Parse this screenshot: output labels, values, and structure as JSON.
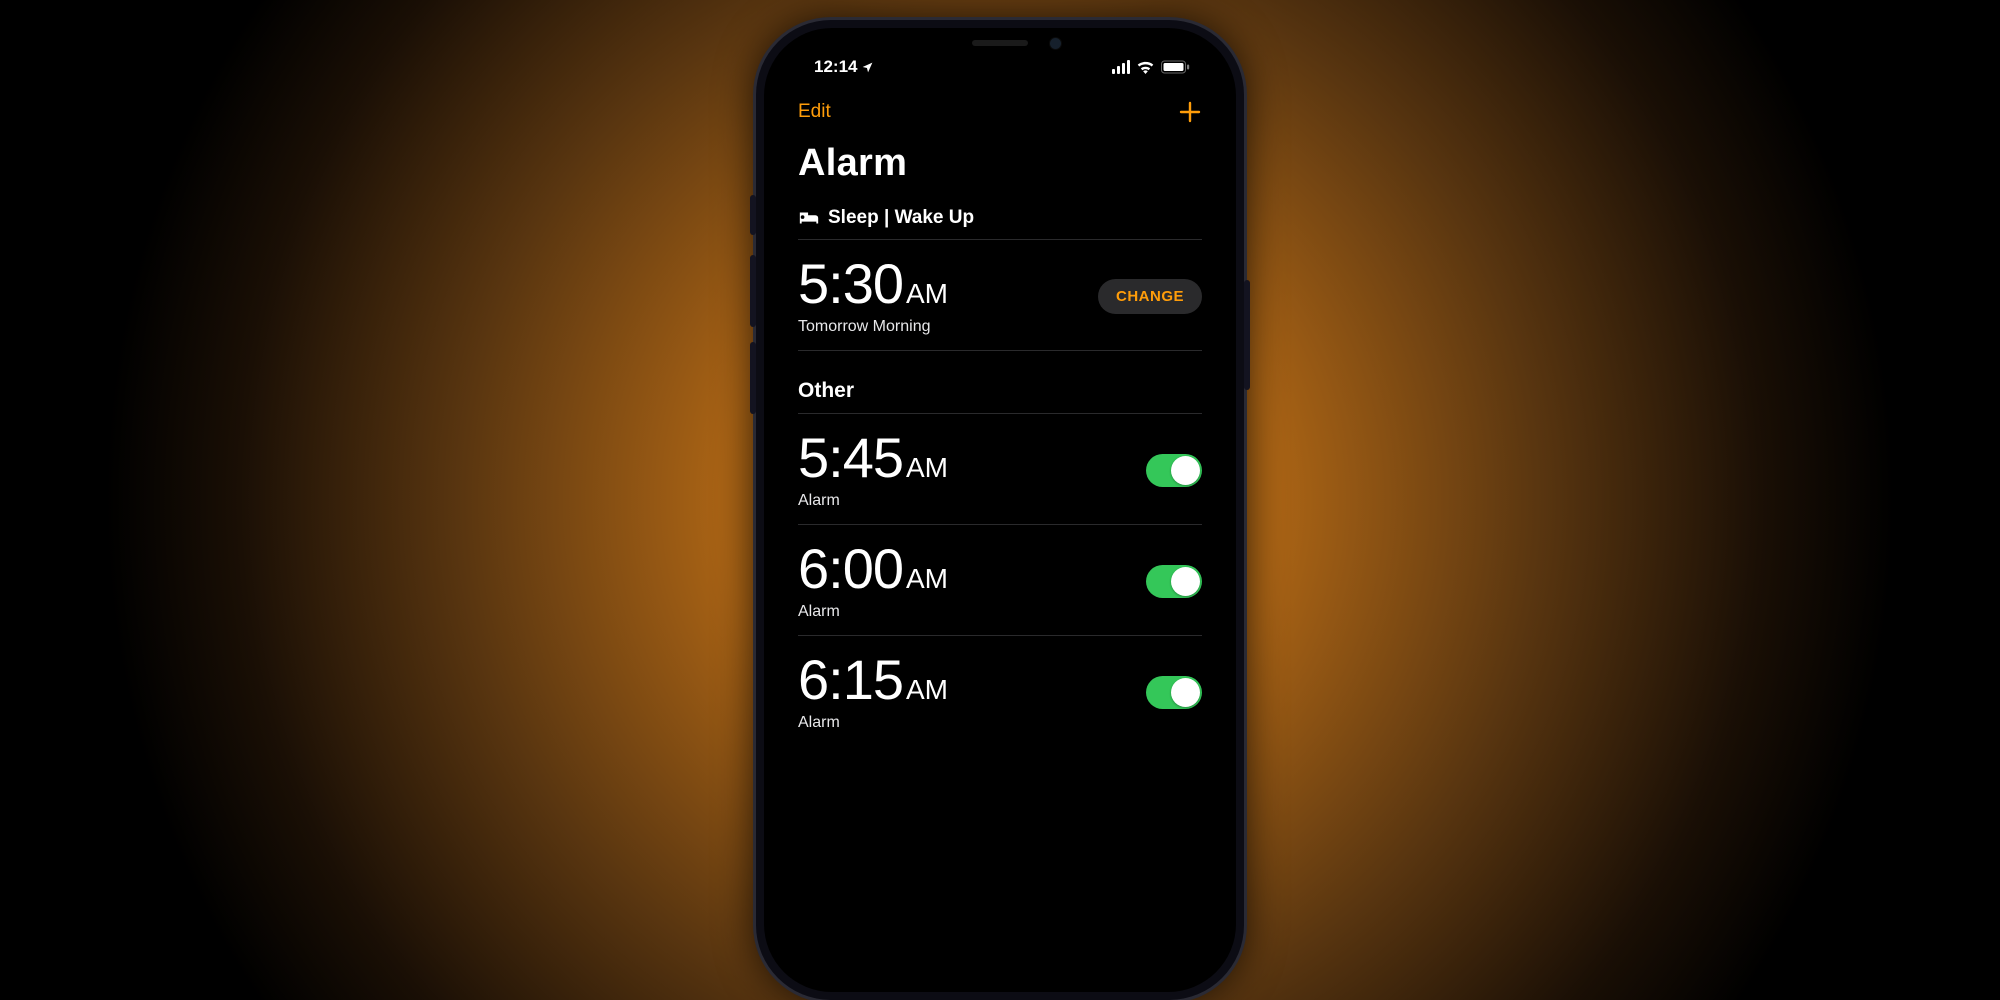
{
  "status": {
    "time": "12:14"
  },
  "nav": {
    "edit": "Edit"
  },
  "title": "Alarm",
  "sleep_section": {
    "label": "Sleep | Wake Up",
    "time": "5:30",
    "ampm": "AM",
    "subtitle": "Tomorrow Morning",
    "change": "CHANGE"
  },
  "other_section": {
    "header": "Other",
    "alarms": [
      {
        "time": "5:45",
        "ampm": "AM",
        "label": "Alarm",
        "on": true
      },
      {
        "time": "6:00",
        "ampm": "AM",
        "label": "Alarm",
        "on": true
      },
      {
        "time": "6:15",
        "ampm": "AM",
        "label": "Alarm",
        "on": true
      }
    ]
  },
  "colors": {
    "accent": "#ff9d0a",
    "toggle_on": "#34c759"
  }
}
